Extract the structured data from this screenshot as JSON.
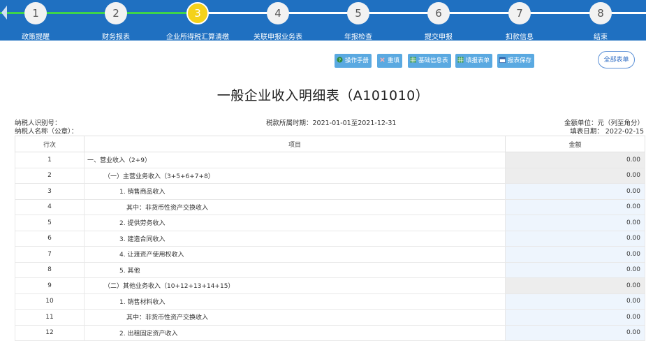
{
  "steps": [
    {
      "num": "1",
      "label": "政策提醒"
    },
    {
      "num": "2",
      "label": "财务报表"
    },
    {
      "num": "3",
      "label": "企业所得税汇算清缴"
    },
    {
      "num": "4",
      "label": "关联申报业务表"
    },
    {
      "num": "5",
      "label": "年报检查"
    },
    {
      "num": "6",
      "label": "提交申报"
    },
    {
      "num": "7",
      "label": "扣款信息"
    },
    {
      "num": "8",
      "label": "结束"
    }
  ],
  "current_step": 3,
  "toolbar": {
    "manual": "操作手册",
    "revoke": "重填",
    "basic_info": "基础信息表",
    "fill_form": "填报表单",
    "save": "报表保存",
    "all_forms": "全部表单"
  },
  "form": {
    "title": "一般企业收入明细表（A101010）",
    "taxpayer_id_label": "纳税人识别号：",
    "taxpayer_name_label": "纳税人名称（公章）：",
    "period": "税款所属时期：2021-01-01至2021-12-31",
    "unit": "金额单位：元（列至角分）",
    "fill_date": "填表日期： 2022-02-15"
  },
  "table": {
    "headers": {
      "no": "行次",
      "item": "项目",
      "amount": "金额"
    },
    "rows": [
      {
        "no": "1",
        "item": "一、营业收入（2+9）",
        "indent": 0,
        "amount": "0.00",
        "calc": true
      },
      {
        "no": "2",
        "item": "（一）主营业务收入（3+5+6+7+8）",
        "indent": 1,
        "amount": "0.00",
        "calc": true
      },
      {
        "no": "3",
        "item": "1. 销售商品收入",
        "indent": 2,
        "amount": "0.00",
        "calc": false
      },
      {
        "no": "4",
        "item": "其中：非货币性资产交换收入",
        "indent": 3,
        "amount": "0.00",
        "calc": false
      },
      {
        "no": "5",
        "item": "2. 提供劳务收入",
        "indent": 2,
        "amount": "0.00",
        "calc": false
      },
      {
        "no": "6",
        "item": "3. 建造合同收入",
        "indent": 2,
        "amount": "0.00",
        "calc": false
      },
      {
        "no": "7",
        "item": "4. 让渡资产使用权收入",
        "indent": 2,
        "amount": "0.00",
        "calc": false
      },
      {
        "no": "8",
        "item": "5. 其他",
        "indent": 2,
        "amount": "0.00",
        "calc": false
      },
      {
        "no": "9",
        "item": "（二）其他业务收入（10+12+13+14+15）",
        "indent": 1,
        "amount": "0.00",
        "calc": true
      },
      {
        "no": "10",
        "item": "1. 销售材料收入",
        "indent": 2,
        "amount": "0.00",
        "calc": false
      },
      {
        "no": "11",
        "item": "其中：非货币性资产交换收入",
        "indent": 3,
        "amount": "0.00",
        "calc": false
      },
      {
        "no": "12",
        "item": "2. 出租固定资产收入",
        "indent": 2,
        "amount": "0.00",
        "calc": false
      }
    ]
  },
  "colors": {
    "header_bg": "#1f70c1",
    "progress_done": "#3ed44a",
    "active_step": "#f4d21a",
    "toolbar_button": "#5aa9e1",
    "calc_cell": "#ededed",
    "input_cell": "#eef5fd"
  },
  "icons": {
    "manual": "question-circle-icon",
    "revoke": "close-icon",
    "basic_info": "grid-table-icon",
    "fill_form": "grid-table-icon",
    "save": "calendar-save-icon"
  }
}
